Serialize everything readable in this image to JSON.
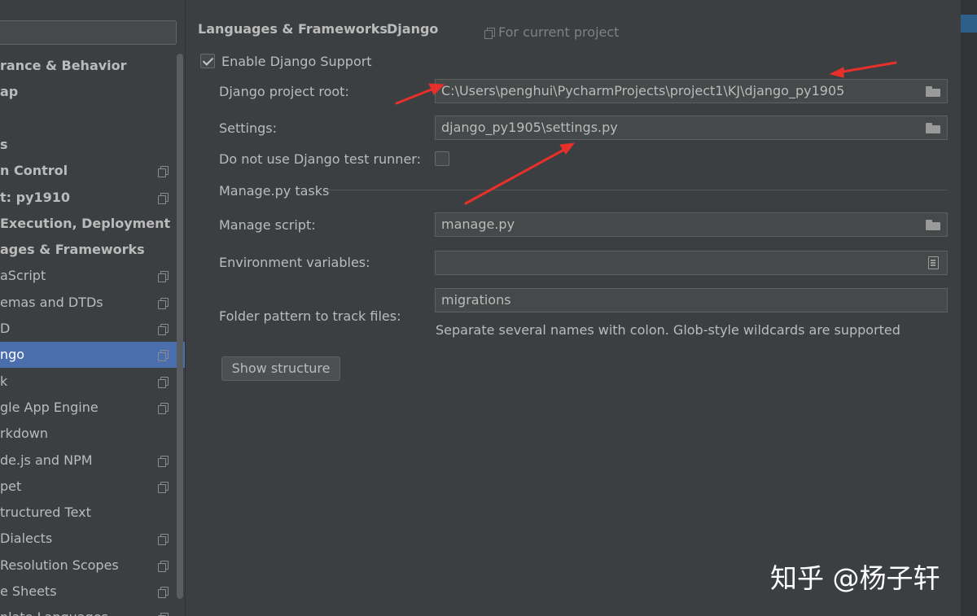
{
  "sidebar": {
    "items": [
      {
        "label": "rance & Behavior",
        "bold": true,
        "copy": false
      },
      {
        "label": "ap",
        "bold": true,
        "copy": false
      },
      {
        "label": "",
        "bold": true,
        "copy": false
      },
      {
        "label": "s",
        "bold": true,
        "copy": false
      },
      {
        "label": "n Control",
        "bold": true,
        "copy": true
      },
      {
        "label": "t: py1910",
        "bold": true,
        "copy": true
      },
      {
        "label": "Execution, Deployment",
        "bold": true,
        "copy": false
      },
      {
        "label": "ages & Frameworks",
        "bold": true,
        "copy": false
      },
      {
        "label": "aScript",
        "bold": false,
        "copy": true
      },
      {
        "label": "emas and DTDs",
        "bold": false,
        "copy": true
      },
      {
        "label": "D",
        "bold": false,
        "copy": true
      },
      {
        "label": "ngo",
        "bold": false,
        "copy": true,
        "selected": true
      },
      {
        "label": "k",
        "bold": false,
        "copy": true
      },
      {
        "label": "gle App Engine",
        "bold": false,
        "copy": true
      },
      {
        "label": "rkdown",
        "bold": false,
        "copy": false
      },
      {
        "label": "de.js and NPM",
        "bold": false,
        "copy": true
      },
      {
        "label": "pet",
        "bold": false,
        "copy": true
      },
      {
        "label": "tructured Text",
        "bold": false,
        "copy": false
      },
      {
        "label": " Dialects",
        "bold": false,
        "copy": true
      },
      {
        "label": " Resolution Scopes",
        "bold": false,
        "copy": true
      },
      {
        "label": "e Sheets",
        "bold": false,
        "copy": true
      },
      {
        "label": "nlate Languages",
        "bold": false,
        "copy": true
      }
    ]
  },
  "header": {
    "breadcrumb_parent": "Languages & Frameworks",
    "breadcrumb_separator": "›",
    "breadcrumb_current": "Django",
    "scope_label": "For current project"
  },
  "form": {
    "enable_label": "Enable Django Support",
    "enable_checked": true,
    "project_root_label": "Django project root:",
    "project_root_value": "C:\\Users\\penghui\\PycharmProjects\\project1\\KJ\\django_py1905",
    "settings_label": "Settings:",
    "settings_value": "django_py1905\\settings.py",
    "test_runner_label": "Do not use Django test runner:",
    "test_runner_checked": false,
    "manage_section_label": "Manage.py tasks",
    "manage_script_label": "Manage script:",
    "manage_script_value": "manage.py",
    "env_vars_label": "Environment variables:",
    "env_vars_value": "",
    "folder_pattern_label": "Folder pattern to track files:",
    "folder_pattern_value": "migrations",
    "folder_pattern_hint": "Separate several names with colon. Glob-style wildcards are supported",
    "show_structure_label": "Show structure"
  },
  "watermark": "知乎 @杨子轩",
  "colors": {
    "background": "#3c3f41",
    "selection": "#4b6eaf",
    "annotation_arrow": "#e8302a"
  }
}
